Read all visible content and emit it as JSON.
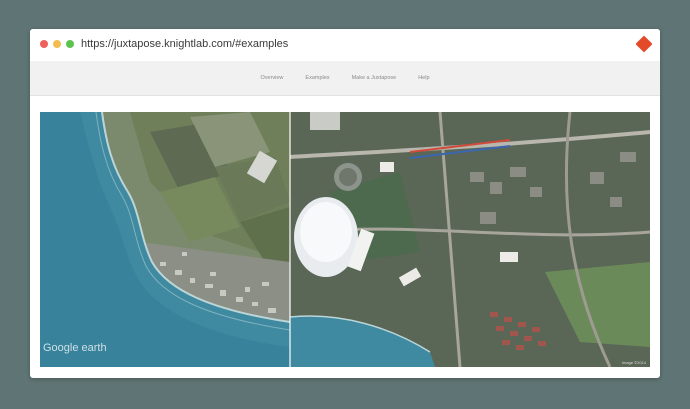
{
  "browser": {
    "url": "https://juxtapose.knightlab.com/#examples",
    "logo_icon": "juxtapose-diamond-icon",
    "logo_color": "#e24a2a"
  },
  "nav": {
    "items": [
      {
        "label": "Overview"
      },
      {
        "label": "Examples"
      },
      {
        "label": "Make a Juxtapose"
      },
      {
        "label": "Help"
      }
    ]
  },
  "slider": {
    "position_percent": 41,
    "left_image": "coastal farmland and beach, before",
    "right_image": "stadium and dense development, after",
    "watermark": "Google earth",
    "attribution": "Image ©2014"
  },
  "colors": {
    "background": "#5f7474",
    "sea": "#3f8aa0",
    "navbar": "#f1f1f1"
  }
}
